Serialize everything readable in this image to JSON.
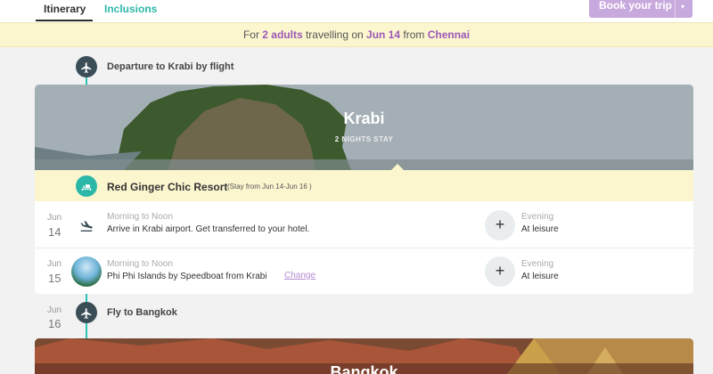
{
  "tabs": {
    "itinerary": "Itinerary",
    "inclusions": "Inclusions"
  },
  "book_button": {
    "label": "Book your trip",
    "caret": "▾"
  },
  "info": {
    "pre": "For ",
    "adults": "2 adults",
    "mid": " travelling on ",
    "date": "Jun 14",
    "from": " from ",
    "city": "Chennai"
  },
  "timeline": {
    "departure": "Departure to Krabi by flight",
    "fly_bangkok": "Fly to Bangkok"
  },
  "krabi": {
    "title": "Krabi",
    "stay": "2 NIGHTS STAY"
  },
  "hotel": {
    "name": "Red Ginger Chic Resort",
    "dates": "(Stay from Jun 14-Jun 16 )"
  },
  "days": [
    {
      "month": "Jun",
      "day": "14",
      "morning_title": "Morning to Noon",
      "morning_text": "Arrive in Krabi airport. Get transferred to your hotel.",
      "evening_title": "Evening",
      "evening_text": "At leisure"
    },
    {
      "month": "Jun",
      "day": "15",
      "morning_title": "Morning to Noon",
      "morning_text": "Phi Phi Islands by Speedboat from Krabi",
      "change": "Change",
      "evening_title": "Evening",
      "evening_text": "At leisure"
    },
    {
      "month": "Jun",
      "day": "16"
    }
  ],
  "bangkok": {
    "title": "Bangkok"
  },
  "colors": {
    "accent_teal": "#2cb8a9",
    "accent_purple": "#9b59b6",
    "dark_icon": "#3b4e58",
    "info_bg": "#fcf6cf"
  },
  "icons": {
    "plane": "plane-icon",
    "bed": "bed-icon",
    "landing": "plane-landing-icon",
    "plus": "plus-icon"
  }
}
